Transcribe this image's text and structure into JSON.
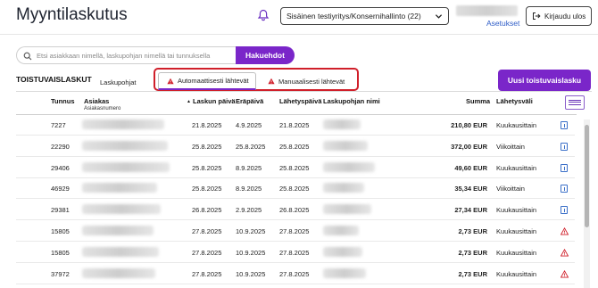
{
  "header": {
    "title": "Myyntilaskutus",
    "org_select": "Sisäinen testiyritys/Konsernihallinto (22)",
    "settings_link": "Asetukset",
    "logout_label": "Kirjaudu ulos"
  },
  "search": {
    "placeholder": "Etsi asiakkaan nimellä, laskupohjan nimellä tai tunnuksella",
    "button_label": "Hakuehdot"
  },
  "tabs": {
    "section_label": "TOISTUVAISLASKUT",
    "templates_label": "Laskupohjat",
    "auto_label": "Automaattisesti lähtevät",
    "manual_label": "Manuaalisesti lähtevät",
    "new_button_label": "Uusi toistuvaislasku"
  },
  "table": {
    "headers": {
      "id": "Tunnus",
      "customer": "Asiakas",
      "customer_sub": "Asiakasnumero",
      "invoice_date": "Laskun päivä",
      "due_date": "Eräpäivä",
      "send_date": "Lähetyspäivä",
      "template_name": "Laskupohjan nimi",
      "sum": "Summa",
      "interval": "Lähetysväli"
    },
    "rows": [
      {
        "id": "7227",
        "invoice_date": "21.8.2025",
        "due_date": "4.9.2025",
        "send_date": "21.8.2025",
        "sum": "210,80 EUR",
        "interval": "Kuukausittain",
        "status_icon": "info-icon"
      },
      {
        "id": "22290",
        "invoice_date": "25.8.2025",
        "due_date": "25.8.2025",
        "send_date": "25.8.2025",
        "sum": "372,00 EUR",
        "interval": "Viikoittain",
        "status_icon": "info-icon"
      },
      {
        "id": "29406",
        "invoice_date": "25.8.2025",
        "due_date": "8.9.2025",
        "send_date": "25.8.2025",
        "sum": "49,60 EUR",
        "interval": "Kuukausittain",
        "status_icon": "info-icon"
      },
      {
        "id": "46929",
        "invoice_date": "25.8.2025",
        "due_date": "8.9.2025",
        "send_date": "25.8.2025",
        "sum": "35,34 EUR",
        "interval": "Viikoittain",
        "status_icon": "info-icon"
      },
      {
        "id": "29381",
        "invoice_date": "26.8.2025",
        "due_date": "2.9.2025",
        "send_date": "26.8.2025",
        "sum": "27,34 EUR",
        "interval": "Kuukausittain",
        "status_icon": "info-icon"
      },
      {
        "id": "15805",
        "invoice_date": "27.8.2025",
        "due_date": "10.9.2025",
        "send_date": "27.8.2025",
        "sum": "2,73 EUR",
        "interval": "Kuukausittain",
        "status_icon": "warning-icon"
      },
      {
        "id": "15805",
        "invoice_date": "27.8.2025",
        "due_date": "10.9.2025",
        "send_date": "27.8.2025",
        "sum": "2,73 EUR",
        "interval": "Kuukausittain",
        "status_icon": "warning-icon"
      },
      {
        "id": "37972",
        "invoice_date": "27.8.2025",
        "due_date": "10.9.2025",
        "send_date": "27.8.2025",
        "sum": "2,73 EUR",
        "interval": "Kuukausittain",
        "status_icon": "warning-icon"
      }
    ]
  },
  "colors": {
    "accent": "#7a26c9",
    "highlight_outline": "#d01f2a",
    "link": "#2f5dc7",
    "warning": "#d01f2a",
    "info": "#3a6fc8"
  }
}
